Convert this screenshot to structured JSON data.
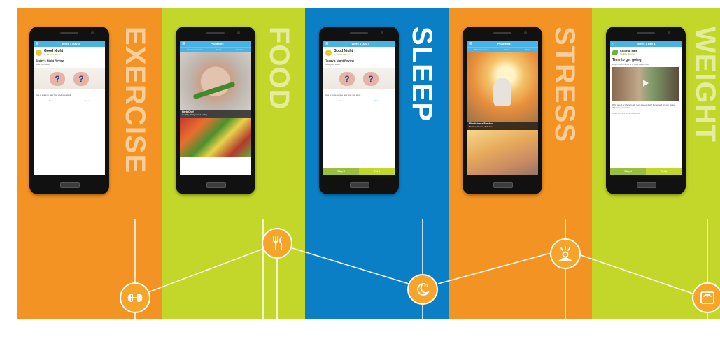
{
  "panels": {
    "exercise": {
      "label": "EXERCISE",
      "color": "#f39323",
      "screen": {
        "title": "Week 4 Day 4",
        "card_title": "Good Night",
        "card_sub": "by Michael Breus",
        "section": "Today's Night Review",
        "section_sub": "Rate your sleep",
        "question": "Use a scale to rate how well you slept",
        "yes": "No",
        "no": "Yes"
      }
    },
    "food": {
      "label": "FOOD",
      "color": "#c3d62a",
      "screen": {
        "title": "Programs",
        "tabs": [
          "Recommended",
          "Food",
          "Exercise"
        ],
        "caption_title": "Herb Chef",
        "caption_sub": "Healthy lifestyle and eating"
      }
    },
    "sleep": {
      "label": "SLEEP",
      "color": "#0a7fc6",
      "screen": {
        "title": "Week 4 Day 4",
        "card_title": "Good Night",
        "card_sub": "by Michael Breus",
        "section": "Today's Night Review",
        "section_sub": "Rate your sleep",
        "question": "Use a scale to rate how well you slept",
        "yes": "No",
        "no": "Yes",
        "skip": "Skip it",
        "got": "Got it"
      }
    },
    "stress": {
      "label": "STRESS",
      "color": "#f39323",
      "screen": {
        "title": "Programs",
        "tabs": [
          "Recommended",
          "Stress",
          "Sleep"
        ],
        "caption_title": "Mindfulness Practice",
        "caption_sub": "Breathe, Center, Release"
      }
    },
    "weight": {
      "label": "WEIGHT",
      "color": "#c3d62a",
      "screen": {
        "title": "Week 1 Day 1",
        "brand": "Colorful Eats",
        "brand_sub": "Healthy Journey",
        "heading": "Time to get going!",
        "intro": "Learn the benefits of a plant-based diet",
        "body": "Why adopt a whole food, plant-based diet? Increased energy, better digestion, plus more",
        "link": "Read about a plant-based diet",
        "skip": "Skip it",
        "got": "Got it"
      }
    }
  },
  "timeline": {
    "line_color": "#ffffff",
    "node_color": "#f7a52a",
    "nodes": [
      {
        "name": "exercise",
        "icon": "dumbbell-icon"
      },
      {
        "name": "food",
        "icon": "fork-knife-icon"
      },
      {
        "name": "sleep",
        "icon": "moon-zzz-icon"
      },
      {
        "name": "stress",
        "icon": "alarm-person-icon"
      },
      {
        "name": "weight",
        "icon": "scale-icon"
      }
    ]
  }
}
